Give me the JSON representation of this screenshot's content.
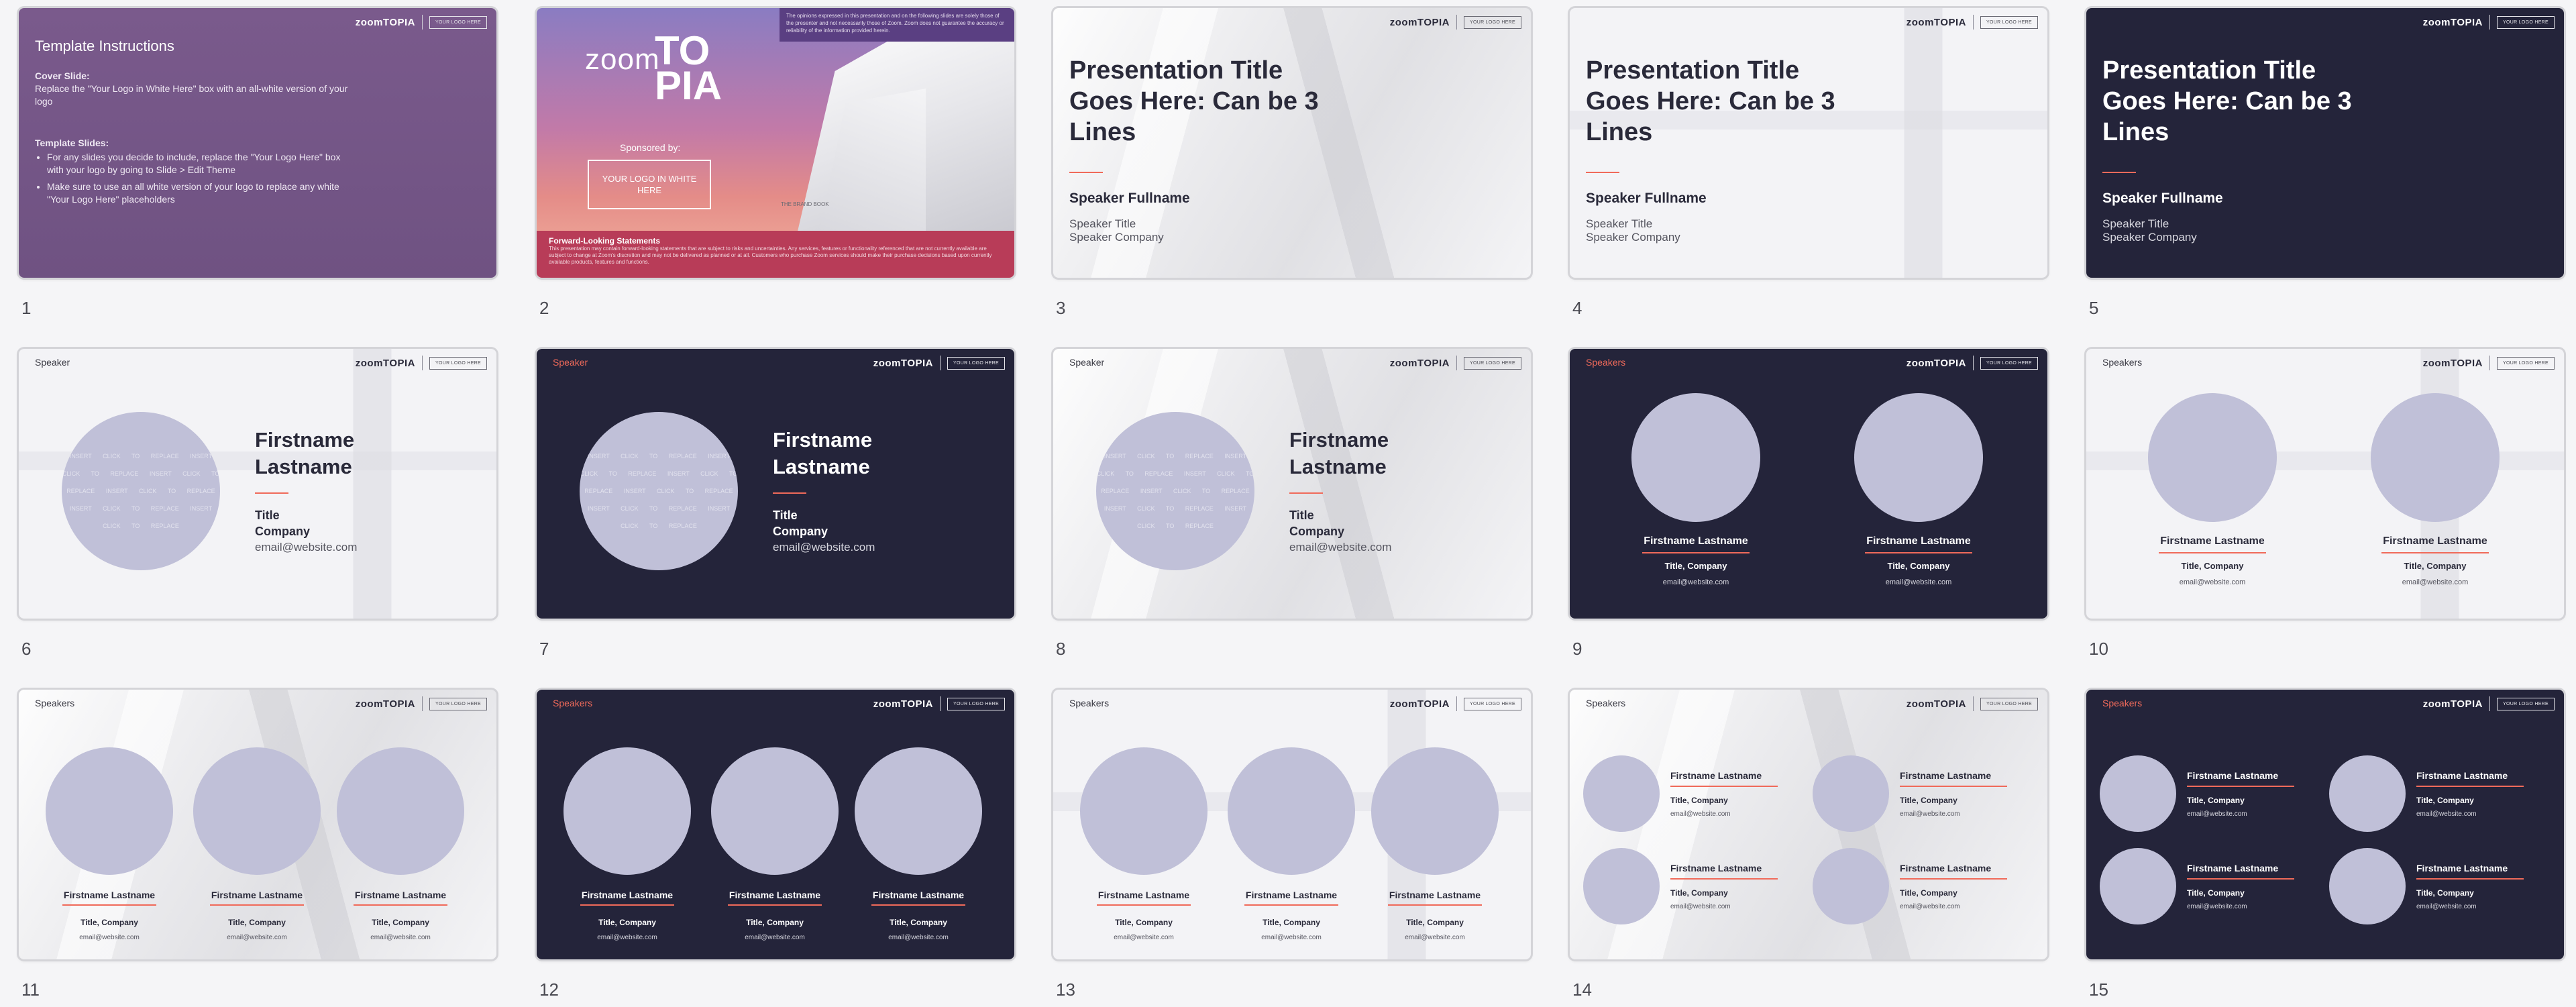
{
  "brand": {
    "wordmark": "zoomTOPIA",
    "logo_box": "YOUR LOGO HERE"
  },
  "slide_numbers": [
    "1",
    "2",
    "3",
    "4",
    "5",
    "6",
    "7",
    "8",
    "9",
    "10",
    "11",
    "12",
    "13",
    "14",
    "15"
  ],
  "slide1": {
    "title": "Template Instructions",
    "cover_heading": "Cover Slide:",
    "cover_text": "Replace the \"Your Logo in White Here\" box with an all-white version of your logo",
    "template_heading": "Template Slides:",
    "bullet1": "For any slides you decide to include, replace the \"Your Logo Here\" box with your logo by going to Slide > Edit Theme",
    "bullet2": "Make sure to use an all white version of your logo to replace any white \"Your Logo Here\" placeholders"
  },
  "slide2": {
    "zoom": "zoom",
    "topia": "TOPIA",
    "sponsored_by": "Sponsored by:",
    "logo_white": "YOUR LOGO IN WHITE HERE",
    "disclaimer": "The opinions expressed in this presentation and on the following slides are solely those of the presenter and not necessarily those of Zoom. Zoom does not guarantee the accuracy or reliability of the information provided herein.",
    "building_mark": "THE BRAND BOOK",
    "fls_heading": "Forward-Looking Statements",
    "fls_text": "This presentation may contain forward-looking statements that are subject to risks and uncertainties. Any services, features or functionality referenced that are not currently available are subject to change at Zoom's discretion and may not be delivered as planned or at all. Customers who purchase Zoom services should make their purchase decisions based upon currently available products, features and functions."
  },
  "title_slide": {
    "title": "Presentation Title Goes Here: Can be 3 Lines",
    "speaker": "Speaker Fullname",
    "speaker_title": "Speaker Title",
    "speaker_company": "Speaker Company"
  },
  "single_speaker": {
    "tag": "Speaker",
    "firstname": "Firstname",
    "lastname": "Lastname",
    "title": "Title",
    "company": "Company",
    "email": "email@website.com",
    "avatar_text": "INSERT CLICK TO REPLACE INSERT CLICK TO REPLACE INSERT CLICK TO REPLACE INSERT CLICK TO REPLACE INSERT CLICK TO REPLACE INSERT CLICK TO REPLACE"
  },
  "multi_speaker": {
    "tag": "Speakers",
    "name": "Firstname Lastname",
    "title_company": "Title, Company",
    "email": "email@website.com"
  }
}
